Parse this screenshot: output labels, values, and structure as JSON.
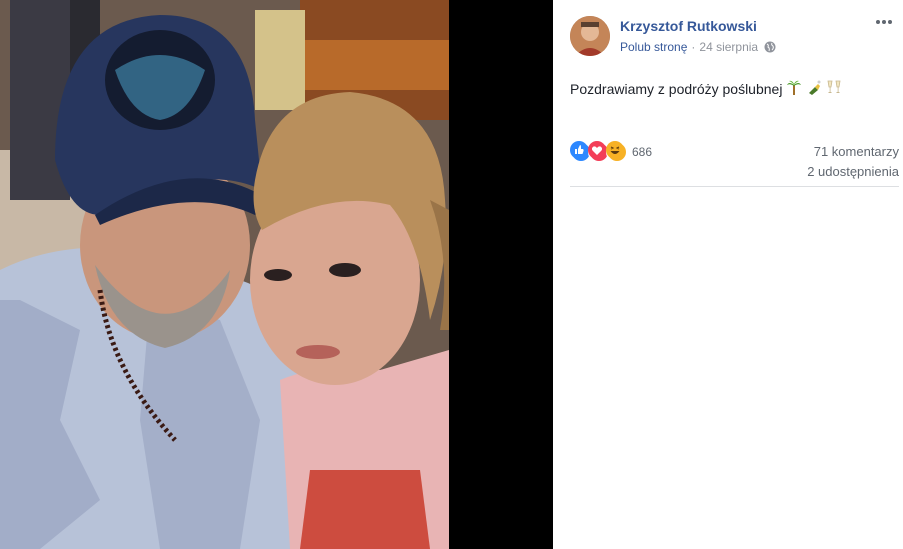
{
  "post": {
    "author": "Krzysztof Rutkowski",
    "like_page": "Polub stronę",
    "date": "24 sierpnia",
    "text": "Pozdrawiamy z podróży poślubnej",
    "emojis": [
      "palm-tree",
      "champagne-bottle",
      "clinking-glasses"
    ]
  },
  "stats": {
    "reactions_count": "686",
    "reaction_types": [
      "like",
      "love",
      "haha"
    ],
    "comments": "71 komentarzy",
    "shares": "2 udostępnienia"
  },
  "colors": {
    "link": "#365899",
    "meta": "#90949c",
    "like": "#2d88ff",
    "love": "#f33e58",
    "haha": "#f7b125"
  }
}
